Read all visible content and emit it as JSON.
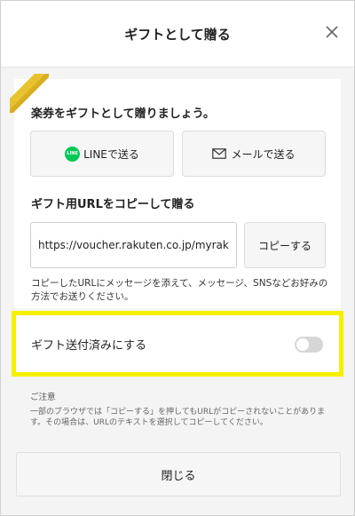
{
  "header": {
    "title": "ギフトとして贈る"
  },
  "intro": "楽券をギフトとして贈りましょう。",
  "share": {
    "line_badge": "LINE",
    "line_label": "LINEで送る",
    "mail_label": "メールで送る"
  },
  "url_section": {
    "title": "ギフト用URLをコピーして贈る",
    "url_value": "https://voucher.rakuten.co.jp/myrak",
    "copy_label": "コピーする",
    "note": "コピーしたURLにメッセージを添えて、メッセージ、SNSなどお好みの方法でお送りください。"
  },
  "toggle": {
    "label": "ギフト送付済みにする",
    "state": "off",
    "highlight_color": "#f6f000"
  },
  "caution": {
    "title": "ご注意",
    "text": "一部のブラウザでは「コピーする」を押してもURLがコピーされないことがあります。その場合は、URLのテキストを選択してコピーしてください。"
  },
  "footer": {
    "close_label": "閉じる"
  },
  "colors": {
    "line_green": "#06c755",
    "ribbon_gold": "#e8c22c"
  }
}
